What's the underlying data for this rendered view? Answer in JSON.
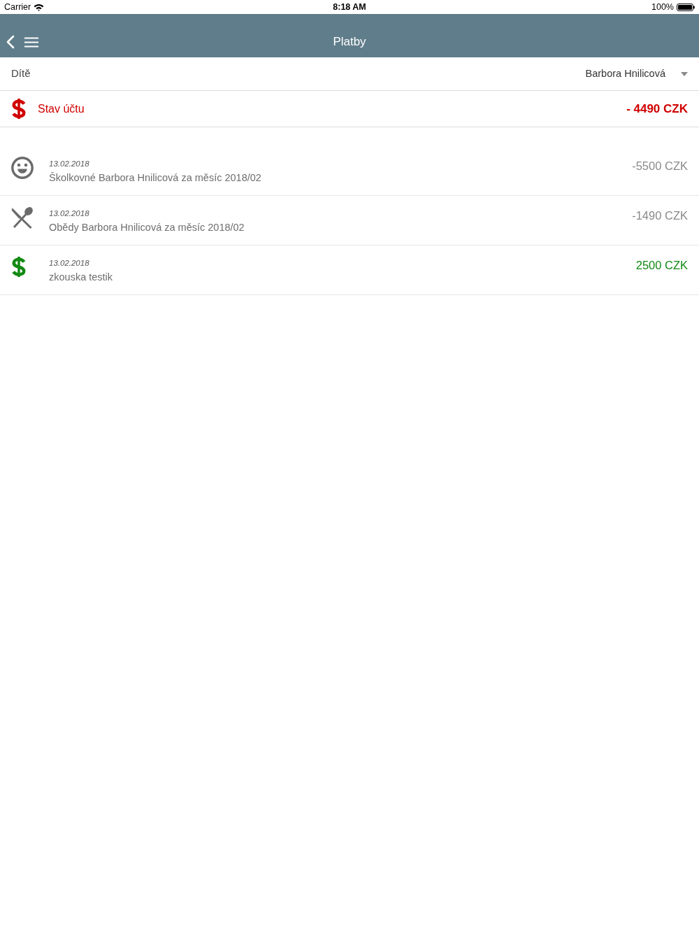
{
  "status_bar": {
    "carrier": "Carrier",
    "time": "8:18 AM",
    "battery": "100%"
  },
  "nav_bar": {
    "title": "Platby"
  },
  "child_select": {
    "label": "Dítě",
    "value": "Barbora Hnilicová"
  },
  "balance": {
    "label": "Stav účtu",
    "amount": "- 4490 CZK"
  },
  "payments": [
    {
      "kind": "school_fee",
      "date": "13.02.2018",
      "description": "Školkovné Barbora Hnilicová za měsíc 2018/02",
      "amount": "-5500 CZK"
    },
    {
      "kind": "meal",
      "date": "13.02.2018",
      "description": "Obědy Barbora Hnilicová za měsíc 2018/02",
      "amount": "-1490 CZK"
    },
    {
      "kind": "deposit",
      "date": "13.02.2018",
      "description": "zkouska testik",
      "amount": "2500 CZK"
    }
  ]
}
